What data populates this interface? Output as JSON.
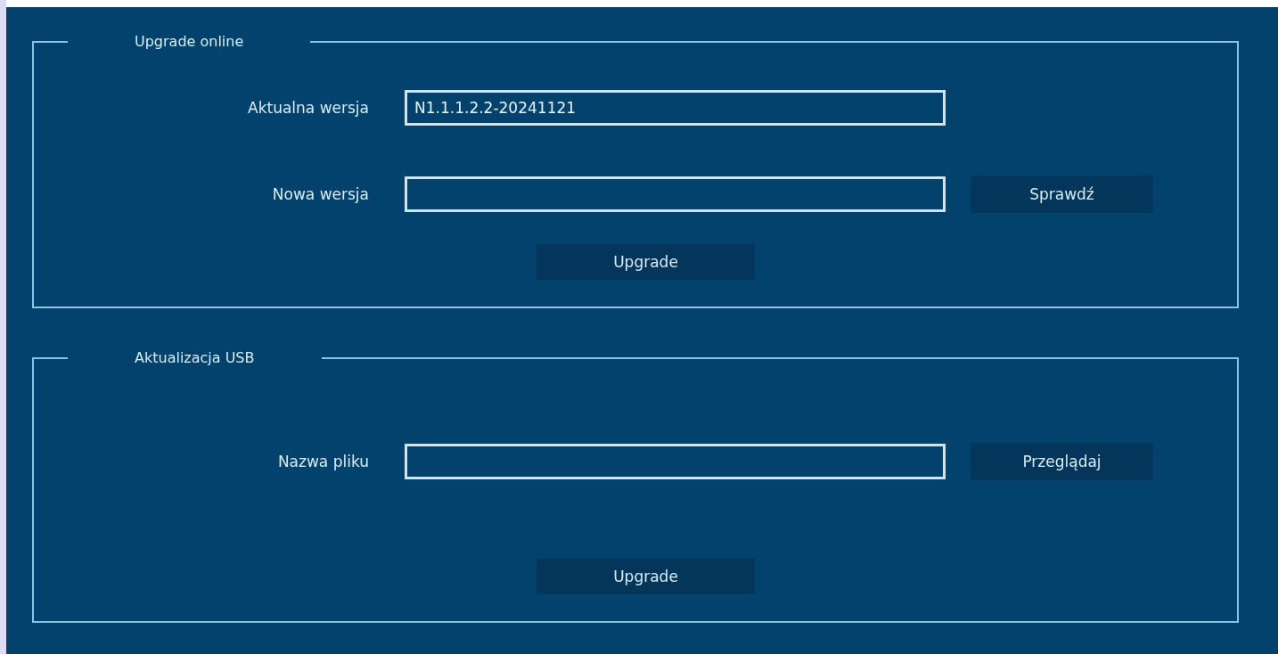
{
  "sections": [
    {
      "title": "Upgrade online",
      "rows": [
        {
          "label": "Aktualna wersja",
          "value": "N1.1.1.2.2-20241121"
        },
        {
          "label": "Nowa wersja",
          "button": "Sprawdź"
        }
      ],
      "action": "Upgrade"
    },
    {
      "title": "Aktualizacja USB",
      "rows": [
        {
          "label": "Nazwa pliku",
          "button": "Przeglądaj"
        }
      ],
      "action": "Upgrade"
    }
  ]
}
